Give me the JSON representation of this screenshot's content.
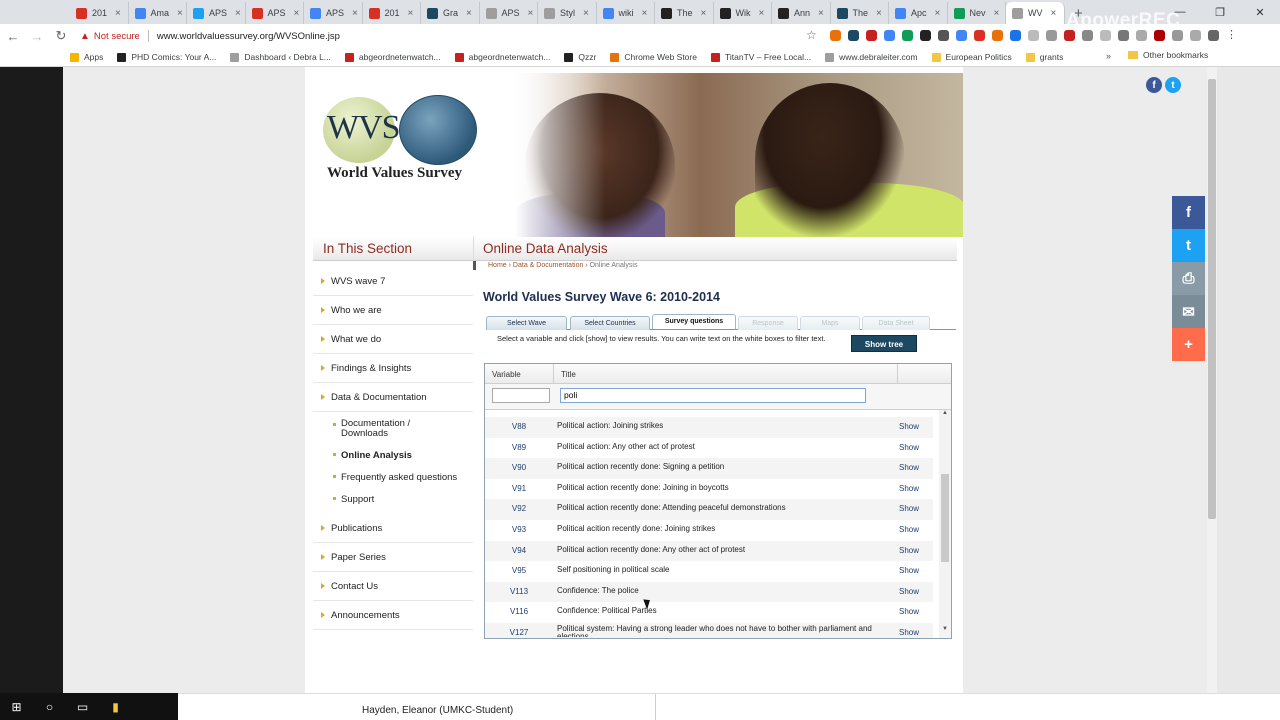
{
  "browser": {
    "tabs": [
      {
        "label": "201",
        "color": "#d93025"
      },
      {
        "label": "Ama",
        "color": "#4285f4"
      },
      {
        "label": "APS",
        "color": "#1da1f2"
      },
      {
        "label": "APS",
        "color": "#d93025"
      },
      {
        "label": "APS",
        "color": "#4285f4"
      },
      {
        "label": "201",
        "color": "#d93025"
      },
      {
        "label": "Gra",
        "color": "#1c4861"
      },
      {
        "label": "APS",
        "color": "#9e9e9e"
      },
      {
        "label": "Styl",
        "color": "#9e9e9e"
      },
      {
        "label": "wiki",
        "color": "#4285f4"
      },
      {
        "label": "The",
        "color": "#222222"
      },
      {
        "label": "Wik",
        "color": "#222222"
      },
      {
        "label": "Ann",
        "color": "#222222"
      },
      {
        "label": "The",
        "color": "#1c4861"
      },
      {
        "label": "Apc",
        "color": "#4285f4"
      },
      {
        "label": "Nev",
        "color": "#0f9d58"
      },
      {
        "label": "WV",
        "color": "#9e9e9e"
      }
    ],
    "new_tab": "+",
    "watermark": "ApowerREC",
    "not_secure": "Not secure",
    "url": "www.worldvaluessurvey.org/WVSOnline.jsp",
    "bookmarks": [
      {
        "label": "Apps",
        "color": "#f4b400"
      },
      {
        "label": "PHD Comics: Your A...",
        "color": "#222222"
      },
      {
        "label": "Dashboard ‹ Debra L...",
        "color": "#9e9e9e"
      },
      {
        "label": "abgeordnetenwatch...",
        "color": "#c5221f"
      },
      {
        "label": "abgeordnetenwatch...",
        "color": "#c5221f"
      },
      {
        "label": "Qzzr",
        "color": "#222222"
      },
      {
        "label": "Chrome Web Store",
        "color": "#e8710a"
      },
      {
        "label": "TitanTV – Free Local...",
        "color": "#c5221f"
      },
      {
        "label": "www.debraleiter.com",
        "color": "#9e9e9e"
      },
      {
        "label": "European Politics",
        "color": "#f2c744"
      },
      {
        "label": "grants",
        "color": "#f2c744"
      }
    ],
    "bookmarks_more": "»",
    "other_bookmarks": "Other bookmarks"
  },
  "site": {
    "logo_text": "WVS",
    "logo_name": "World Values Survey",
    "section_title": "In This Section",
    "page_heading": "Online Data Analysis",
    "breadcrumb": {
      "home": "Home",
      "sep1": " › ",
      "docs": "Data & Documentation",
      "sep2": " › ",
      "current": "Online Analysis"
    }
  },
  "sidebar": {
    "items": [
      {
        "label": "WVS wave 7"
      },
      {
        "label": "Who we are"
      },
      {
        "label": "What we do"
      },
      {
        "label": "Findings & Insights"
      },
      {
        "label": "Data & Documentation"
      }
    ],
    "subitems": [
      {
        "label": "Documentation / Downloads"
      },
      {
        "label": "Online Analysis"
      },
      {
        "label": "Frequently asked questions"
      },
      {
        "label": "Support"
      }
    ],
    "items_after": [
      {
        "label": "Publications"
      },
      {
        "label": "Paper Series"
      },
      {
        "label": "Contact Us"
      },
      {
        "label": "Announcements"
      }
    ]
  },
  "main": {
    "wave_title": "World Values Survey Wave 6: 2010-2014",
    "tabs": [
      {
        "label": "Select Wave"
      },
      {
        "label": "Select Countries"
      },
      {
        "label": "Survey questions"
      },
      {
        "label": "Response"
      },
      {
        "label": "Maps"
      },
      {
        "label": "Data Sheet"
      }
    ],
    "hint": "Select a variable and click [show] to view results. You can write text on the white boxes to filter text.",
    "show_tree": "Show tree",
    "table": {
      "col_variable": "Variable",
      "col_title": "Title",
      "filter_variable": "",
      "filter_title": "poli",
      "rows": [
        {
          "var": "V88",
          "title": "Political action: Joining strikes",
          "action": "Show"
        },
        {
          "var": "V89",
          "title": "Political action: Any other act of protest",
          "action": "Show"
        },
        {
          "var": "V90",
          "title": "Political action recently done: Signing a petition",
          "action": "Show"
        },
        {
          "var": "V91",
          "title": "Political action recently done: Joining in boycotts",
          "action": "Show"
        },
        {
          "var": "V92",
          "title": "Political action recently done: Attending peaceful demonstrations",
          "action": "Show"
        },
        {
          "var": "V93",
          "title": "Political acition recently done: Joining strikes",
          "action": "Show"
        },
        {
          "var": "V94",
          "title": "Political action recently done: Any other act of protest",
          "action": "Show"
        },
        {
          "var": "V95",
          "title": "Self positioning in political scale",
          "action": "Show"
        },
        {
          "var": "V113",
          "title": "Confidence: The police",
          "action": "Show"
        },
        {
          "var": "V116",
          "title": "Confidence: Political Parties",
          "action": "Show"
        },
        {
          "var": "V127",
          "title": "Political system: Having a strong leader who does not have to bother with parliament and elections",
          "action": "Show"
        }
      ]
    }
  },
  "social": {
    "facebook": "f",
    "twitter": "t",
    "share_colors": [
      "#3b5998",
      "#1da1f2",
      "#8a9ba8",
      "#7b8c99",
      "#ff6c4c"
    ],
    "share_icons": [
      "f",
      "t",
      "⎙",
      "✉",
      "+"
    ]
  },
  "overlay": {
    "name": "Hayden, Eleanor (UMKC-Student)"
  }
}
